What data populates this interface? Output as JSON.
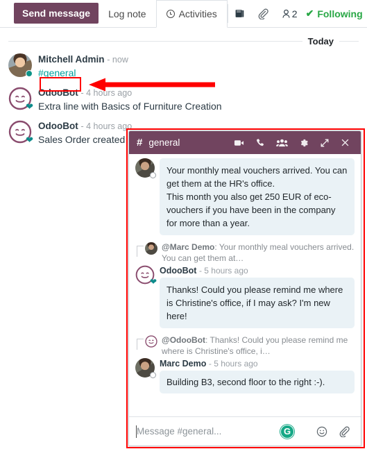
{
  "tabs": {
    "send_message": "Send message",
    "log_note": "Log note",
    "activities": "Activities"
  },
  "toolbar": {
    "note_icon": "book-icon",
    "attachment_icon": "paperclip-icon",
    "followers_icon": "user-icon",
    "followers_count": "2",
    "following_label": "Following",
    "following_check": "✔",
    "following_color": "#28a745"
  },
  "thread": {
    "day_separator": "Today",
    "messages": [
      {
        "author": "Mitchell Admin",
        "time": "- now",
        "body": "#general",
        "body_is_link": true,
        "avatar": "photo-mitchell"
      },
      {
        "author": "OdooBot",
        "time": "- 4 hours ago",
        "body": "Extra line with Basics of Furniture Creation",
        "body_is_link": false,
        "avatar": "odoobot"
      },
      {
        "author": "OdooBot",
        "time": "- 4 hours ago",
        "body": "Sales Order created",
        "body_is_link": false,
        "avatar": "odoobot"
      }
    ]
  },
  "chat_window": {
    "hash": "#",
    "title": "general",
    "icons": [
      "video-camera-icon",
      "phone-icon",
      "group-members-icon",
      "gear-icon",
      "expand-icon",
      "close-icon"
    ],
    "messages": [
      {
        "type": "message",
        "author": "",
        "time": "",
        "avatar": "photo-marc",
        "text": "Your monthly meal vouchers arrived. You can get them at the HR's office.\nThis month you also get 250 EUR of eco-vouchers if you have been in the company for more than a year."
      },
      {
        "type": "quote",
        "avatar": "photo-marc",
        "name": "@Marc Demo",
        "text": ":  Your monthly meal vouchers arrived. You can get them at…"
      },
      {
        "type": "message",
        "author": "OdooBot",
        "time": "- 5 hours ago",
        "avatar": "odoobot",
        "text": "Thanks! Could you please remind me where is Christine's office, if I may ask? I'm new here!"
      },
      {
        "type": "quote",
        "avatar": "odoobot",
        "name": "@OdooBot",
        "text": ":  Thanks! Could you please remind me where is Christine's office, i…"
      },
      {
        "type": "message",
        "author": "Marc Demo",
        "time": "- 5 hours ago",
        "avatar": "photo-marc",
        "text": "Building B3, second floor to the right :-)."
      }
    ],
    "composer": {
      "placeholder": "Message #general...",
      "grammarly_badge": "G",
      "emoji_icon": "smiley-icon",
      "attachment_icon": "paperclip-icon"
    }
  },
  "annotations": {
    "highlight_color": "#ff0000",
    "channel_link_box": "#general",
    "arrow_direction": "left"
  },
  "colors": {
    "brand_purple": "#71445f",
    "link_teal": "#00A09D",
    "bubble": "#eaf2f6",
    "annotation_red": "#ff0000"
  }
}
